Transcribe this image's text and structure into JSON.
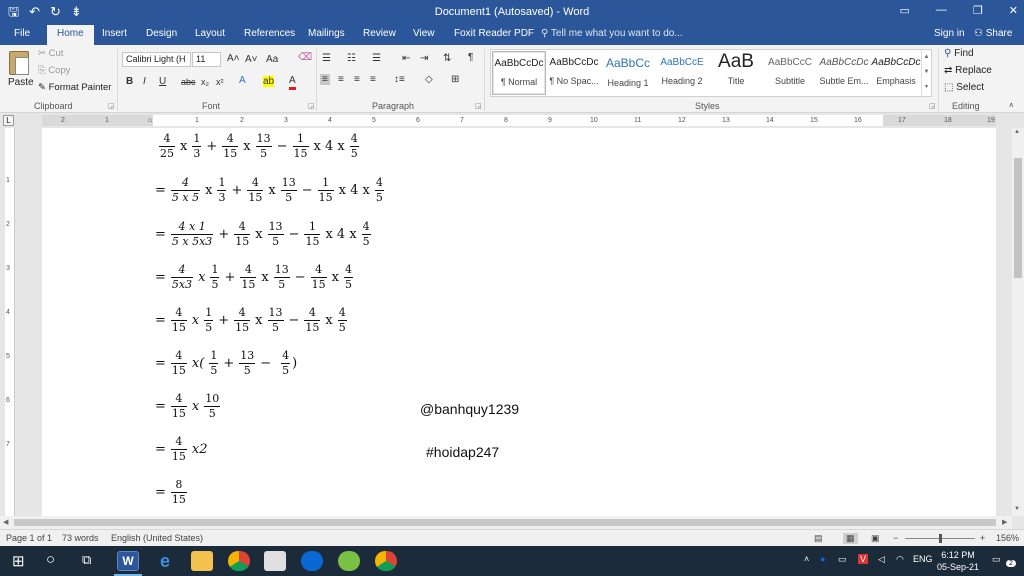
{
  "window": {
    "title": "Document1 (Autosaved) - Word",
    "qat": {
      "save": "🖫",
      "undo": "↶",
      "redo": "↻",
      "customize": "⇟"
    }
  },
  "tabs": {
    "items": [
      "File",
      "Home",
      "Insert",
      "Design",
      "Layout",
      "References",
      "Mailings",
      "Review",
      "View",
      "Foxit Reader PDF"
    ],
    "tell_me": "Tell me what you want to do...",
    "sign_in": "Sign in",
    "share": "Share"
  },
  "ribbon": {
    "clipboard": {
      "paste": "Paste",
      "cut": "Cut",
      "copy": "Copy",
      "format_painter": "Format Painter",
      "label": "Clipboard"
    },
    "font": {
      "name": "Calibri Light (H",
      "size": "11",
      "label": "Font"
    },
    "paragraph": {
      "label": "Paragraph"
    },
    "styles": {
      "label": "Styles",
      "items": [
        {
          "preview": "AaBbCcDc",
          "name": "¶ Normal"
        },
        {
          "preview": "AaBbCcDc",
          "name": "¶ No Spac..."
        },
        {
          "preview": "AaBbCc",
          "name": "Heading 1"
        },
        {
          "preview": "AaBbCcE",
          "name": "Heading 2"
        },
        {
          "preview": "AaB",
          "name": "Title"
        },
        {
          "preview": "AaBbCcC",
          "name": "Subtitle"
        },
        {
          "preview": "AaBbCcDc",
          "name": "Subtle Em..."
        },
        {
          "preview": "AaBbCcDc",
          "name": "Emphasis"
        }
      ]
    },
    "editing": {
      "find": "Find",
      "replace": "Replace",
      "select": "Select",
      "label": "Editing"
    }
  },
  "ruler": {
    "h_numbers": [
      "2",
      "1",
      "1",
      "2",
      "3",
      "4",
      "5",
      "6",
      "7",
      "8",
      "9",
      "10",
      "11",
      "12",
      "13",
      "14",
      "15",
      "16",
      "17",
      "18",
      "19"
    ],
    "v_numbers": [
      "1",
      "2",
      "3",
      "4",
      "5",
      "6",
      "7"
    ]
  },
  "document": {
    "l1": {
      "a_n": "4",
      "a_d": "25",
      "x1": "x",
      "b_n": "1",
      "b_d": "3",
      "plus": "+",
      "c_n": "4",
      "c_d": "15",
      "x2": "x",
      "d_n": "13",
      "d_d": "5",
      "minus": "−",
      "e_n": "1",
      "e_d": "15",
      "tail": "x 4 x",
      "f_n": "4",
      "f_d": "5"
    },
    "l2": {
      "eq": "=",
      "a_n": "4",
      "a_d": "5 x 5",
      "x1": "x",
      "b_n": "1",
      "b_d": "3",
      "plus": "+",
      "c_n": "4",
      "c_d": "15",
      "x2": "x",
      "d_n": "13",
      "d_d": "5",
      "minus": "−",
      "e_n": "1",
      "e_d": "15",
      "tail": "x 4 x",
      "f_n": "4",
      "f_d": "5"
    },
    "l3": {
      "eq": "=",
      "a_n": "4 x 1",
      "a_d": "5 x 5x3",
      "plus": "+",
      "c_n": "4",
      "c_d": "15",
      "x2": "x",
      "d_n": "13",
      "d_d": "5",
      "minus": "−",
      "e_n": "1",
      "e_d": "15",
      "tail": "x 4 x",
      "f_n": "4",
      "f_d": "5"
    },
    "l4": {
      "eq": "=",
      "a_n": "4",
      "a_d": "5x3",
      "x1": "x",
      "b_n": "1",
      "b_d": "5",
      "plus": "+",
      "c_n": "4",
      "c_d": "15",
      "x2": "x",
      "d_n": "13",
      "d_d": "5",
      "minus": "−",
      "e_n": "4",
      "e_d": "15",
      "x3": "x",
      "f_n": "4",
      "f_d": "5"
    },
    "l5": {
      "eq": "=",
      "a_n": "4",
      "a_d": "15",
      "x1": "x",
      "b_n": "1",
      "b_d": "5",
      "plus": "+",
      "c_n": "4",
      "c_d": "15",
      "x2": "x",
      "d_n": "13",
      "d_d": "5",
      "minus": "−",
      "e_n": "4",
      "e_d": "15",
      "x3": "x",
      "f_n": "4",
      "f_d": "5"
    },
    "l6": {
      "eq": "=",
      "a_n": "4",
      "a_d": "15",
      "x1": "x(",
      "b_n": "1",
      "b_d": "5",
      "plus": "+",
      "d_n": "13",
      "d_d": "5",
      "minus": "−",
      "f_n": "4",
      "f_d": "5",
      "close": ")"
    },
    "l7": {
      "eq": "=",
      "a_n": "4",
      "a_d": "15",
      "x1": "x",
      "b_n": "10",
      "b_d": "5"
    },
    "l8": {
      "eq": "=",
      "a_n": "4",
      "a_d": "15",
      "x1": "x2"
    },
    "l9": {
      "eq": "=",
      "a_n": "8",
      "a_d": "15"
    },
    "watermark1": "@banhquy1239",
    "watermark2": "#hoidap247"
  },
  "status": {
    "page": "Page 1 of 1",
    "words": "73 words",
    "language": "English (United States)",
    "zoom": "156%"
  },
  "taskbar": {
    "lang": "ENG",
    "time": "6:12 PM",
    "date": "05-Sep-21",
    "notifications": "2"
  }
}
